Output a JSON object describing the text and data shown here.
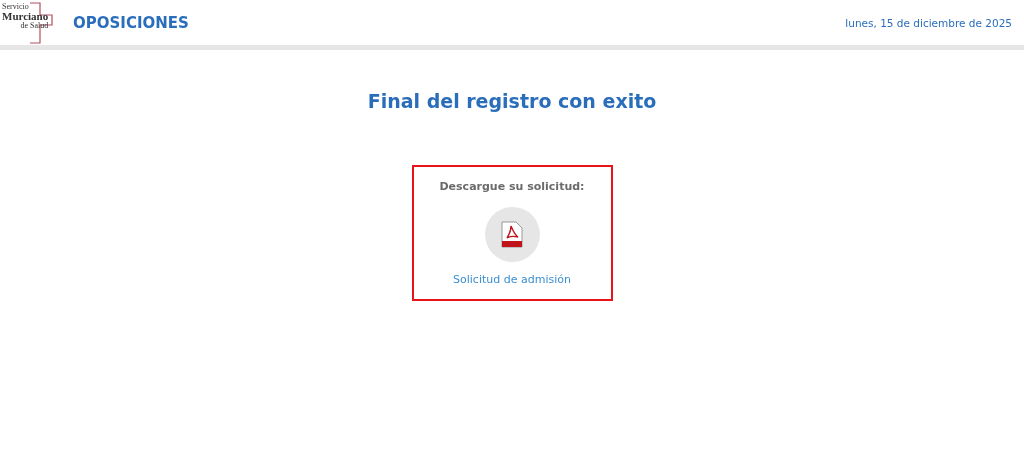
{
  "header": {
    "logo_lines": [
      "Servicio",
      "Murciano",
      "de Salud"
    ],
    "title": "OPOSICIONES",
    "date": "lunes, 15 de diciembre de 2025"
  },
  "page_title": "Final del registro con exito",
  "download": {
    "heading": "Descargue su solicitud:",
    "link": "Solicitud de admisión"
  }
}
